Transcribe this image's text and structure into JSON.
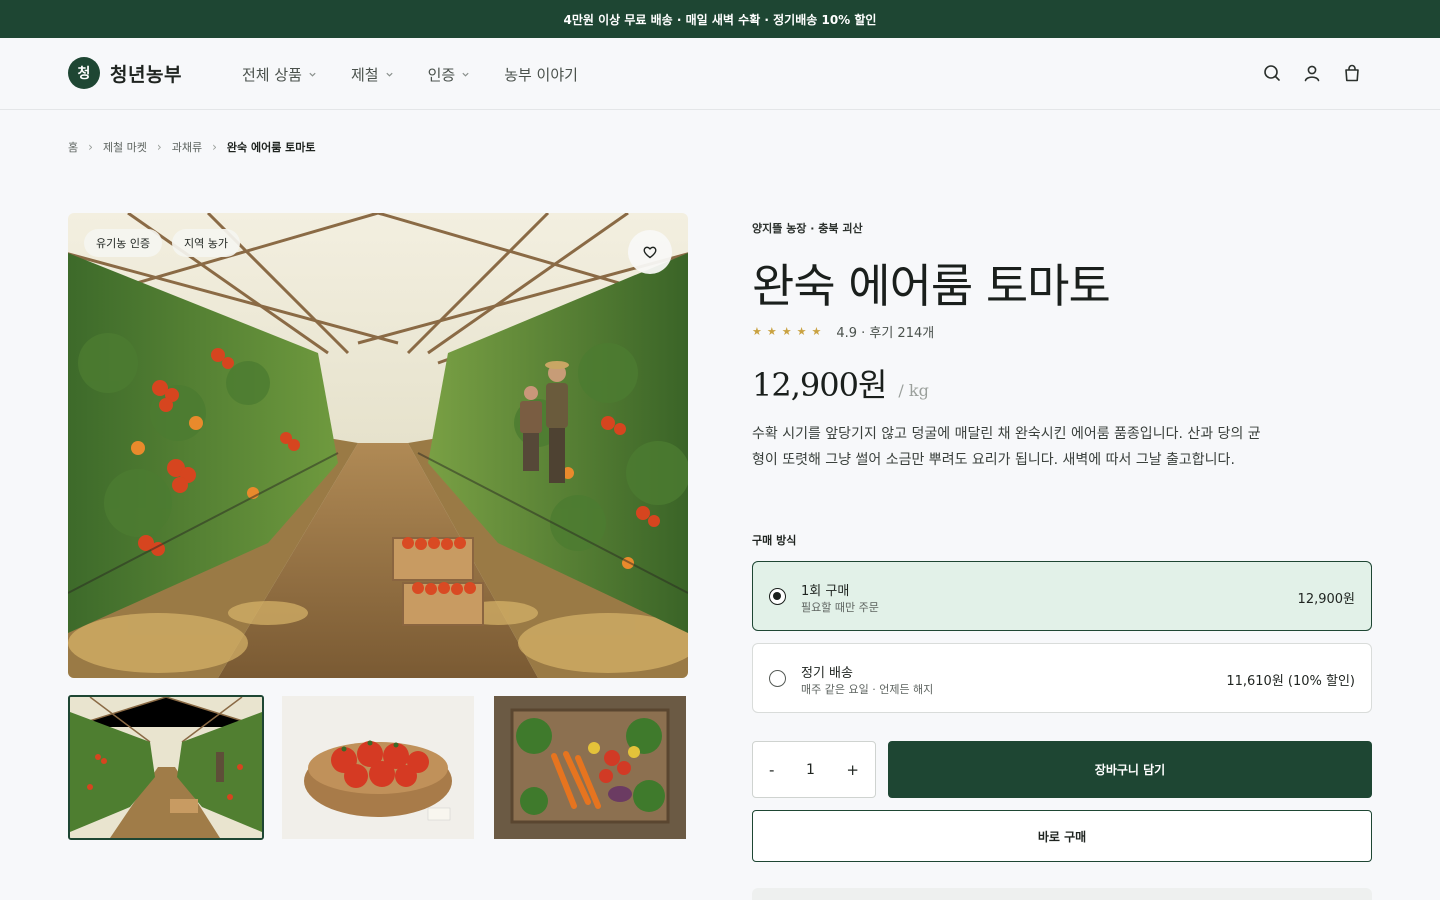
{
  "promo": {
    "text": "4만원 이상 무료 배송 · 매일 새벽 수확 · 정기배송 10% 할인"
  },
  "header": {
    "logo_mark": "청",
    "logo_text": "청년농부",
    "nav": [
      {
        "label": "전체 상품",
        "dropdown": true
      },
      {
        "label": "제철",
        "dropdown": true
      },
      {
        "label": "인증",
        "dropdown": true
      },
      {
        "label": "농부 이야기",
        "dropdown": false
      }
    ],
    "icons": [
      "search-icon",
      "user-icon",
      "cart-icon"
    ]
  },
  "breadcrumb": [
    "홈",
    "제철 마켓",
    "과채류",
    "완숙 에어룸 토마토"
  ],
  "gallery": {
    "badges": [
      "유기농 인증",
      "지역 농가"
    ],
    "thumbnails": [
      "greenhouse-thumbnail",
      "tomato-basket-thumbnail",
      "vegetable-crate-thumbnail"
    ],
    "selected_thumbnail": 0
  },
  "product": {
    "farm": "양지뜰 농장 · 충북 괴산",
    "title": "완숙 에어룸 토마토",
    "stars": "★★★★★",
    "rating_text": "4.9 · 후기 214개",
    "price": "12,900원",
    "unit": "/ kg",
    "description": "수확 시기를 앞당기지 않고 덩굴에 매달린 채 완숙시킨 에어룸 품종입니다. 산과 당의 균형이 또렷해 그냥 썰어 소금만 뿌려도 요리가 됩니다. 새벽에 따서 그날 출고합니다."
  },
  "purchase": {
    "label": "구매 방식",
    "options": [
      {
        "title": "1회 구매",
        "subtitle": "필요할 때만 주문",
        "price": "12,900원",
        "selected": true
      },
      {
        "title": "정기 배송",
        "subtitle": "매주 같은 요일 · 언제든 해지",
        "price": "11,610원 (10% 할인)",
        "selected": false
      }
    ],
    "quantity": "1",
    "minus": "-",
    "plus": "+",
    "add_to_cart": "장바구니 담기",
    "buy_now": "바로 구매"
  },
  "colors": {
    "brand_green": "#1e4633",
    "selected_bg": "#e2f1e8",
    "star_gold": "#c9a241"
  }
}
